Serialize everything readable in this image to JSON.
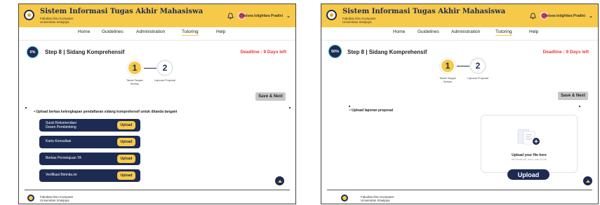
{
  "header": {
    "app_title": "Sistem Informasi Tugas Akhir Mahasiswa",
    "faculty": "Fakultas Ilmu Komputer",
    "university": "Universitas Sriwijaya",
    "user_name": "Chelsea Istighfara Pradini"
  },
  "nav": {
    "items": [
      "Home",
      "Guidelines",
      "Administration",
      "Tutoring",
      "Help"
    ],
    "active": "Tutoring"
  },
  "step": {
    "title": "Step 8 | Sidang Komprehensif",
    "deadline": "Deadline : 9 Days left"
  },
  "stepper": {
    "steps": [
      {
        "number": "1",
        "label_line1": "Tanda Tangan",
        "label_line2": "Berkas"
      },
      {
        "number": "2",
        "label_line1": "Laporan Proposal",
        "label_line2": ""
      }
    ]
  },
  "buttons": {
    "save_next": "Save & Next",
    "upload_small": "Upload",
    "upload_big": "Upload"
  },
  "panel_left": {
    "progress": "0%",
    "instruction": "• Upload berkas kelengkapan pendaftaran sidang komprehensif untuk ditanda tangani",
    "documents": [
      {
        "line1": "Surat Rekomendasi",
        "line2": "Dosen Pembimbing"
      },
      {
        "line1": "Kartu Konsultasi",
        "line2": ""
      },
      {
        "line1": "Berkas Persetujuan TA",
        "line2": ""
      },
      {
        "line1": "Verifikasi Bimnita.ini",
        "line2": ""
      }
    ]
  },
  "panel_right": {
    "progress": "50%",
    "instruction": "• Upload laporan proposal",
    "drop_title": "Upload your file here",
    "drop_subtitle": "file format pdf, docx, max 10 mb"
  },
  "footer": {
    "line1": "Fakultas Ilmu Komputer",
    "line2": "Universitas Sriwijaya"
  },
  "colors": {
    "accent_yellow": "#f7c948",
    "navy": "#1d2b52",
    "deadline_red": "#e53935",
    "progress_ring": "#2fa7c8"
  }
}
